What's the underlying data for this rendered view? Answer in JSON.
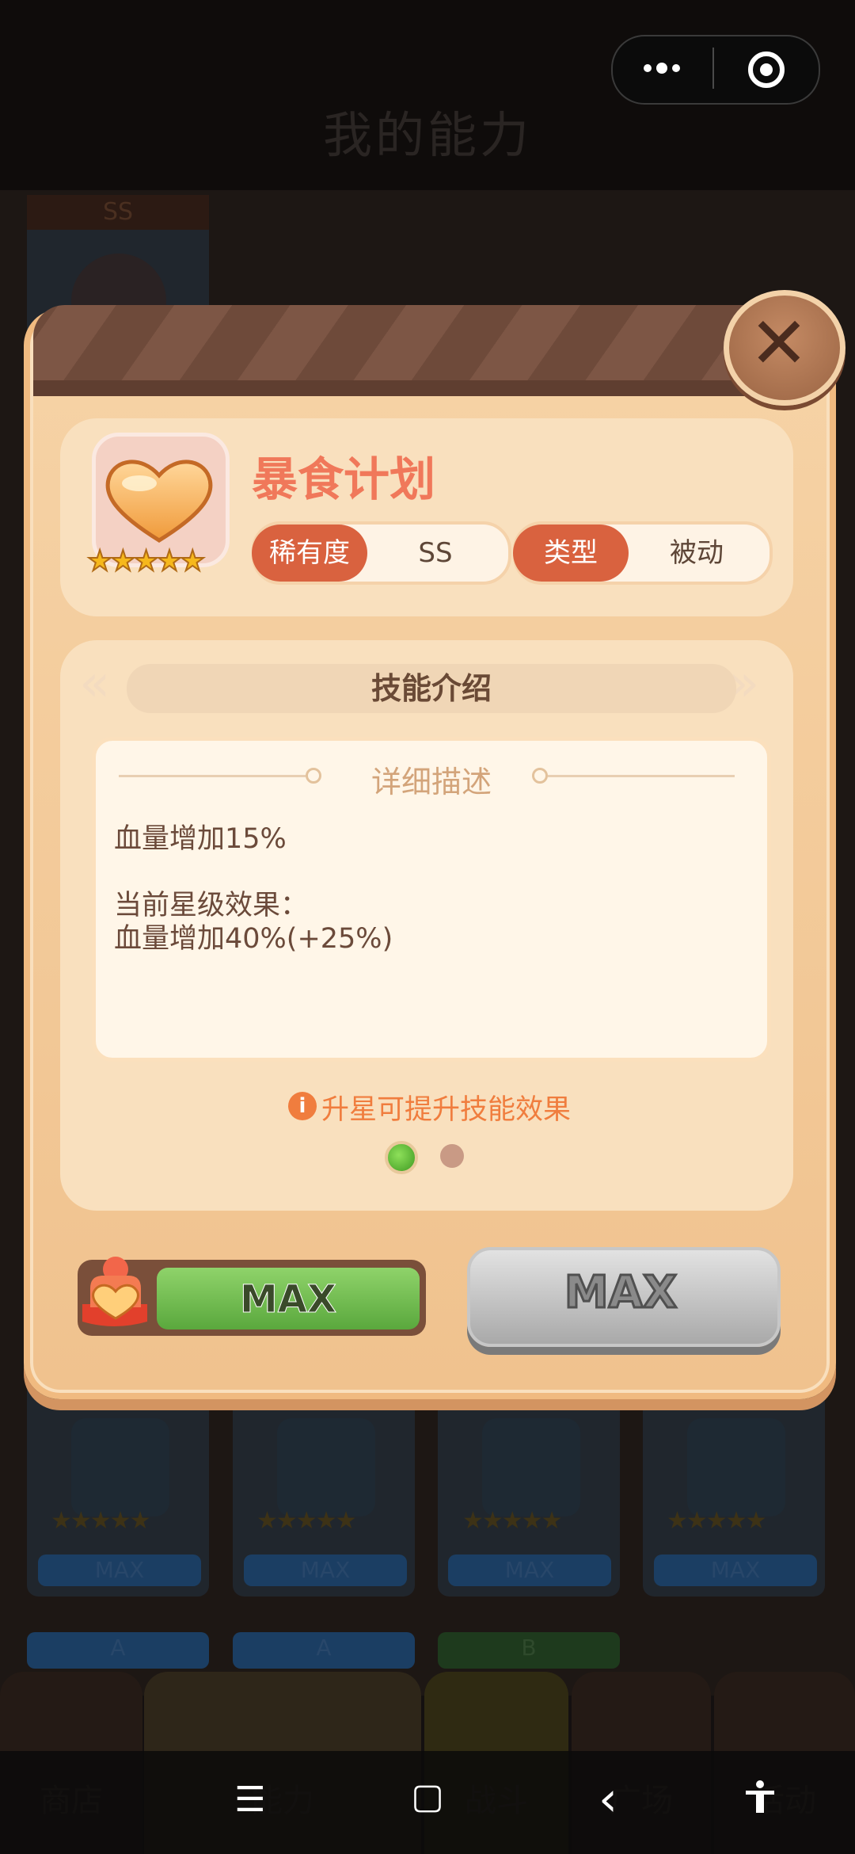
{
  "background": {
    "page_title": "我的能力",
    "rarity_top": "SS",
    "cards_row": [
      {
        "max_label": "MAX",
        "stars": "★★★★★"
      },
      {
        "max_label": "MAX",
        "stars": "★★★★★"
      },
      {
        "max_label": "MAX",
        "stars": "★★★★★"
      },
      {
        "max_label": "MAX",
        "stars": "★★★★★"
      }
    ],
    "rarity_row": [
      "A",
      "A",
      "B"
    ],
    "tabs": [
      "商店",
      "能力",
      "战斗",
      "广场",
      "活动"
    ]
  },
  "modal": {
    "skill": {
      "name": "暴食计划",
      "stars": "★★★★★",
      "rarity_key": "稀有度",
      "rarity_value": "SS",
      "type_key": "类型",
      "type_value": "被动"
    },
    "section_title": "技能介绍",
    "detail_title": "详细描述",
    "description_lines": [
      "血量增加15%",
      "",
      "当前星级效果：",
      "血量增加40%(+25%)"
    ],
    "tip": "升星可提升技能效果",
    "tip_icon": "i",
    "pager": {
      "current": 1,
      "total": 2
    },
    "buttons": {
      "upgrade_label": "MAX",
      "second_label": "MAX"
    }
  },
  "icons": {
    "close": "close-icon",
    "skill": "heart-icon",
    "menu": "more-dots-icon",
    "target": "target-icon"
  },
  "system_nav": {
    "menu": "☰",
    "home": "▢",
    "back": "‹",
    "accessibility": "accessibility-icon"
  },
  "colors": {
    "accent": "#d9623f",
    "name": "#f0785a",
    "tip": "#f07d3e",
    "green_button": "#6fbf4b"
  }
}
